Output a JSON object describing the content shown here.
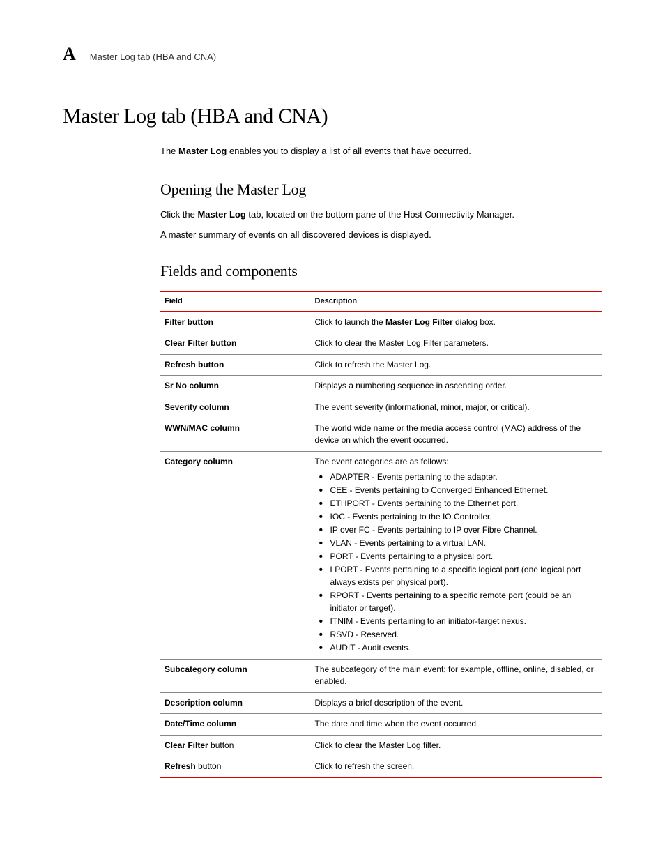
{
  "header": {
    "appendix_letter": "A",
    "breadcrumb": "Master Log tab (HBA and CNA)"
  },
  "title": "Master Log tab (HBA and CNA)",
  "intro": {
    "prefix": "The ",
    "bold": "Master Log",
    "suffix": " enables you to display a list of all events that have occurred."
  },
  "sections": {
    "opening": {
      "heading": "Opening the Master Log",
      "p1_prefix": "Click the ",
      "p1_bold": "Master Log",
      "p1_suffix": " tab, located on the bottom pane of the Host Connectivity Manager.",
      "p2": "A master summary of events on all discovered devices is displayed."
    },
    "fields": {
      "heading": "Fields and components",
      "col_field": "Field",
      "col_desc": "Description",
      "rows": [
        {
          "field": "Filter button",
          "desc_prefix": "Click to launch the ",
          "desc_bold": "Master Log Filter",
          "desc_suffix": " dialog box."
        },
        {
          "field": "Clear Filter button",
          "desc": "Click to clear the Master Log Filter parameters."
        },
        {
          "field": "Refresh button",
          "desc": "Click to refresh the Master Log."
        },
        {
          "field": "Sr No column",
          "desc": "Displays a numbering sequence in ascending order."
        },
        {
          "field": "Severity column",
          "desc": "The event severity (informational, minor, major, or critical)."
        },
        {
          "field": "WWN/MAC column",
          "desc": "The world wide name or the media access control (MAC) address of the device on which the event occurred."
        },
        {
          "field": "Category column",
          "desc_lead": "The event categories are as follows:",
          "categories": [
            "ADAPTER - Events pertaining to the adapter.",
            "CEE - Events pertaining to Converged Enhanced Ethernet.",
            "ETHPORT - Events pertaining to the Ethernet port.",
            "IOC - Events pertaining to the IO Controller.",
            "IP over FC - Events pertaining to IP over Fibre Channel.",
            "VLAN - Events pertaining to a virtual LAN.",
            "PORT - Events pertaining to a physical port.",
            "LPORT - Events pertaining to a specific logical port (one logical port always exists per physical port).",
            "RPORT - Events pertaining to a specific remote port (could be an initiator or target).",
            "ITNIM - Events pertaining to an initiator-target nexus.",
            "RSVD - Reserved.",
            "AUDIT - Audit events."
          ]
        },
        {
          "field": "Subcategory column",
          "desc": "The subcategory of the main event; for example, offline, online, disabled, or enabled."
        },
        {
          "field": "Description column",
          "desc": "Displays a brief description of the event."
        },
        {
          "field": "Date/Time column",
          "desc": "The date and time when the event occurred."
        },
        {
          "field_bold": "Clear Filter",
          "field_rest": " button",
          "desc": "Click to clear the Master Log filter."
        },
        {
          "field_bold": "Refresh",
          "field_rest": " button",
          "desc": "Click to refresh the screen."
        }
      ]
    }
  }
}
